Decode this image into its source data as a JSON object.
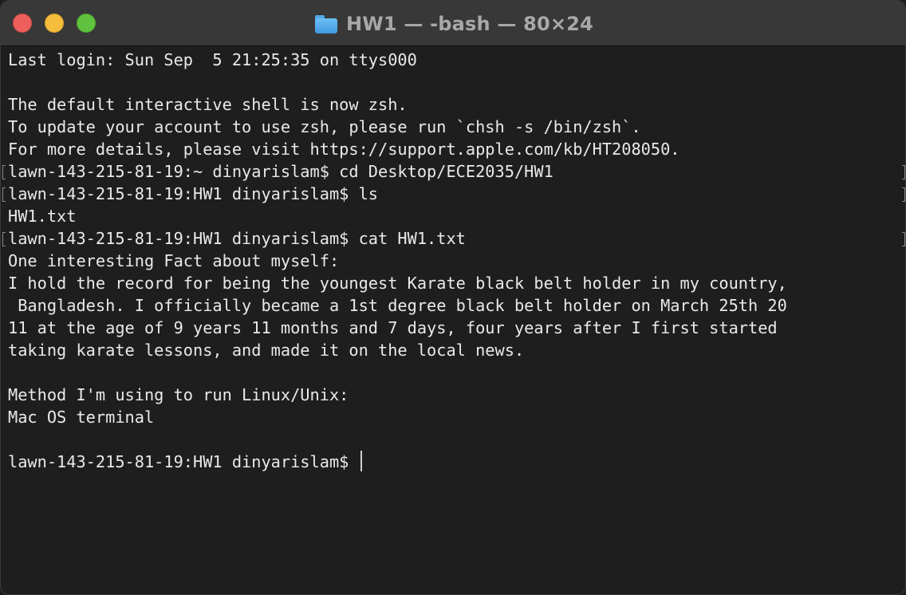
{
  "window": {
    "title": "HW1 — -bash — 80×24",
    "title_icon": "folder-icon",
    "traffic_lights": {
      "close": "#ec5f5a",
      "minimize": "#f4bd3c",
      "maximize": "#5fc13d"
    }
  },
  "terminal": {
    "background": "#1e1e1e",
    "foreground": "#e9e9e9",
    "lines": [
      "Last login: Sun Sep  5 21:25:35 on ttys000",
      "",
      "The default interactive shell is now zsh.",
      "To update your account to use zsh, please run `chsh -s /bin/zsh`.",
      "For more details, please visit https://support.apple.com/kb/HT208050.",
      "lawn-143-215-81-19:~ dinyarislam$ cd Desktop/ECE2035/HW1",
      "lawn-143-215-81-19:HW1 dinyarislam$ ls",
      "HW1.txt",
      "lawn-143-215-81-19:HW1 dinyarislam$ cat HW1.txt",
      "One interesting Fact about myself:",
      "I hold the record for being the youngest Karate black belt holder in my country,",
      " Bangladesh. I officially became a 1st degree black belt holder on March 25th 20",
      "11 at the age of 9 years 11 months and 7 days, four years after I first started",
      "taking karate lessons, and made it on the local news.",
      "",
      "Method I'm using to run Linux/Unix:",
      "Mac OS terminal",
      "",
      "lawn-143-215-81-19:HW1 dinyarislam$ "
    ]
  }
}
